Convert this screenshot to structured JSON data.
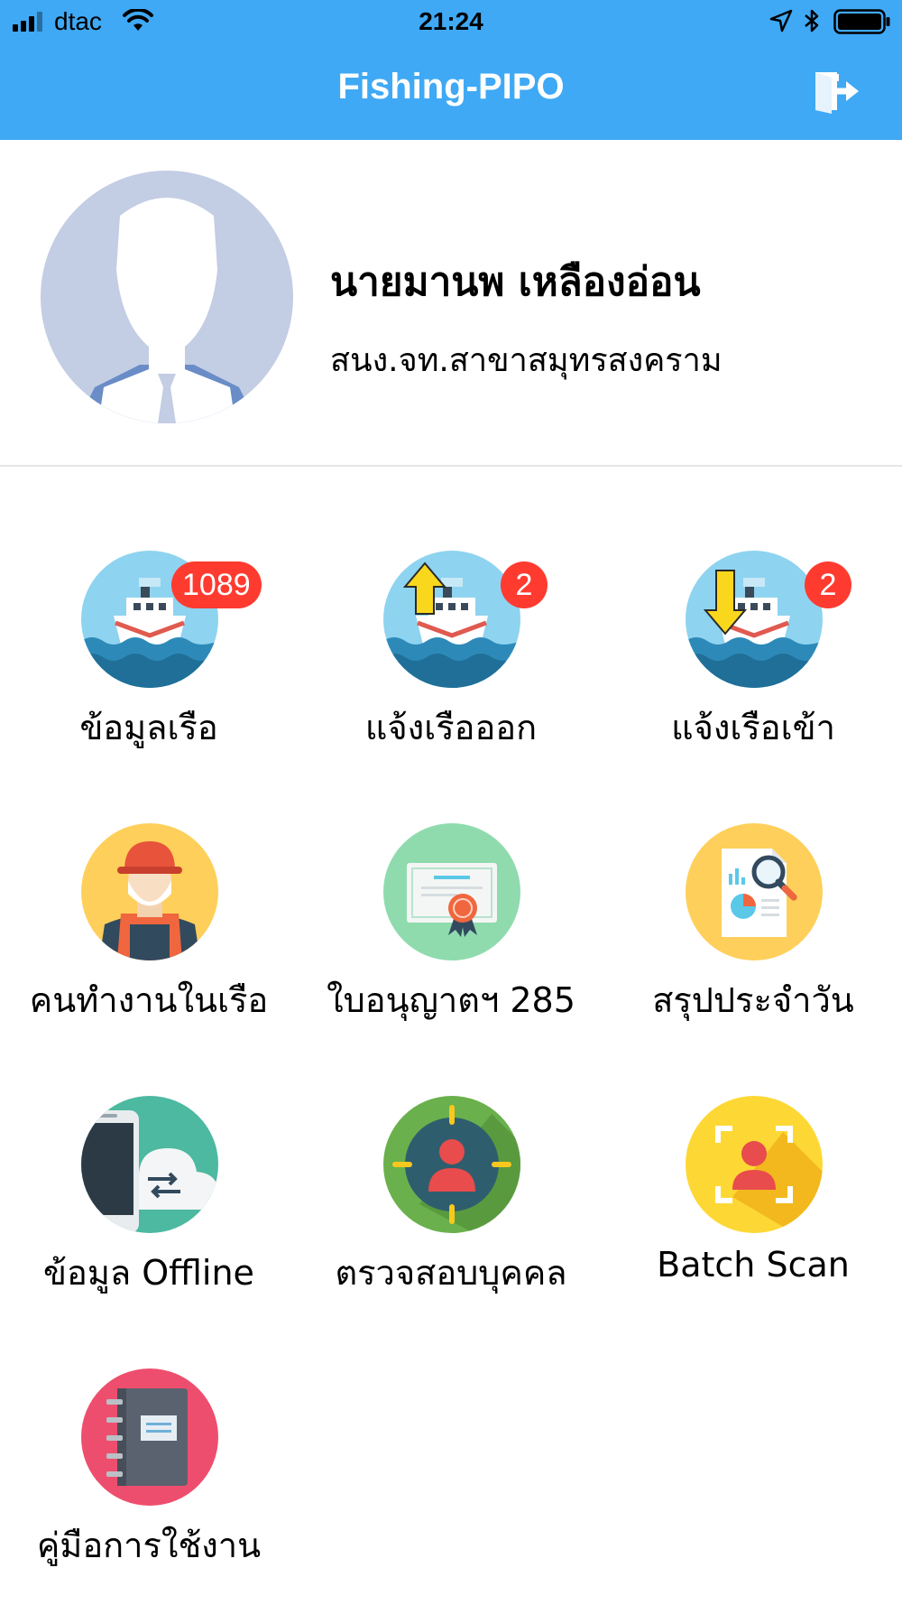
{
  "status_bar": {
    "carrier": "dtac",
    "time": "21:24"
  },
  "header": {
    "title": "Fishing-PIPO",
    "logout_icon": "logout-icon",
    "background_color": "#3fa9f5"
  },
  "profile": {
    "name": "นายมานพ เหลืองอ่อน",
    "office": "สนง.จท.สาขาสมุทรสงคราม",
    "avatar_icon": "avatar-placeholder"
  },
  "menu": [
    {
      "label": "ข้อมูลเรือ",
      "icon": "ship-icon",
      "badge": "1089"
    },
    {
      "label": "แจ้งเรือออก",
      "icon": "ship-departure-icon",
      "badge": "2"
    },
    {
      "label": "แจ้งเรือเข้า",
      "icon": "ship-arrival-icon",
      "badge": "2"
    },
    {
      "label": "คนทำงานในเรือ",
      "icon": "crew-worker-icon"
    },
    {
      "label": "ใบอนุญาตฯ 285",
      "icon": "certificate-icon"
    },
    {
      "label": "สรุปประจำวัน",
      "icon": "daily-report-icon"
    },
    {
      "label": "ข้อมูล Offline",
      "icon": "offline-sync-icon"
    },
    {
      "label": "ตรวจสอบบุคคล",
      "icon": "person-target-icon"
    },
    {
      "label": "Batch Scan",
      "icon": "face-scan-icon"
    },
    {
      "label": "คู่มือการใช้งาน",
      "icon": "manual-book-icon"
    }
  ],
  "colors": {
    "badge": "#ff3b30",
    "header": "#3fa9f5"
  }
}
